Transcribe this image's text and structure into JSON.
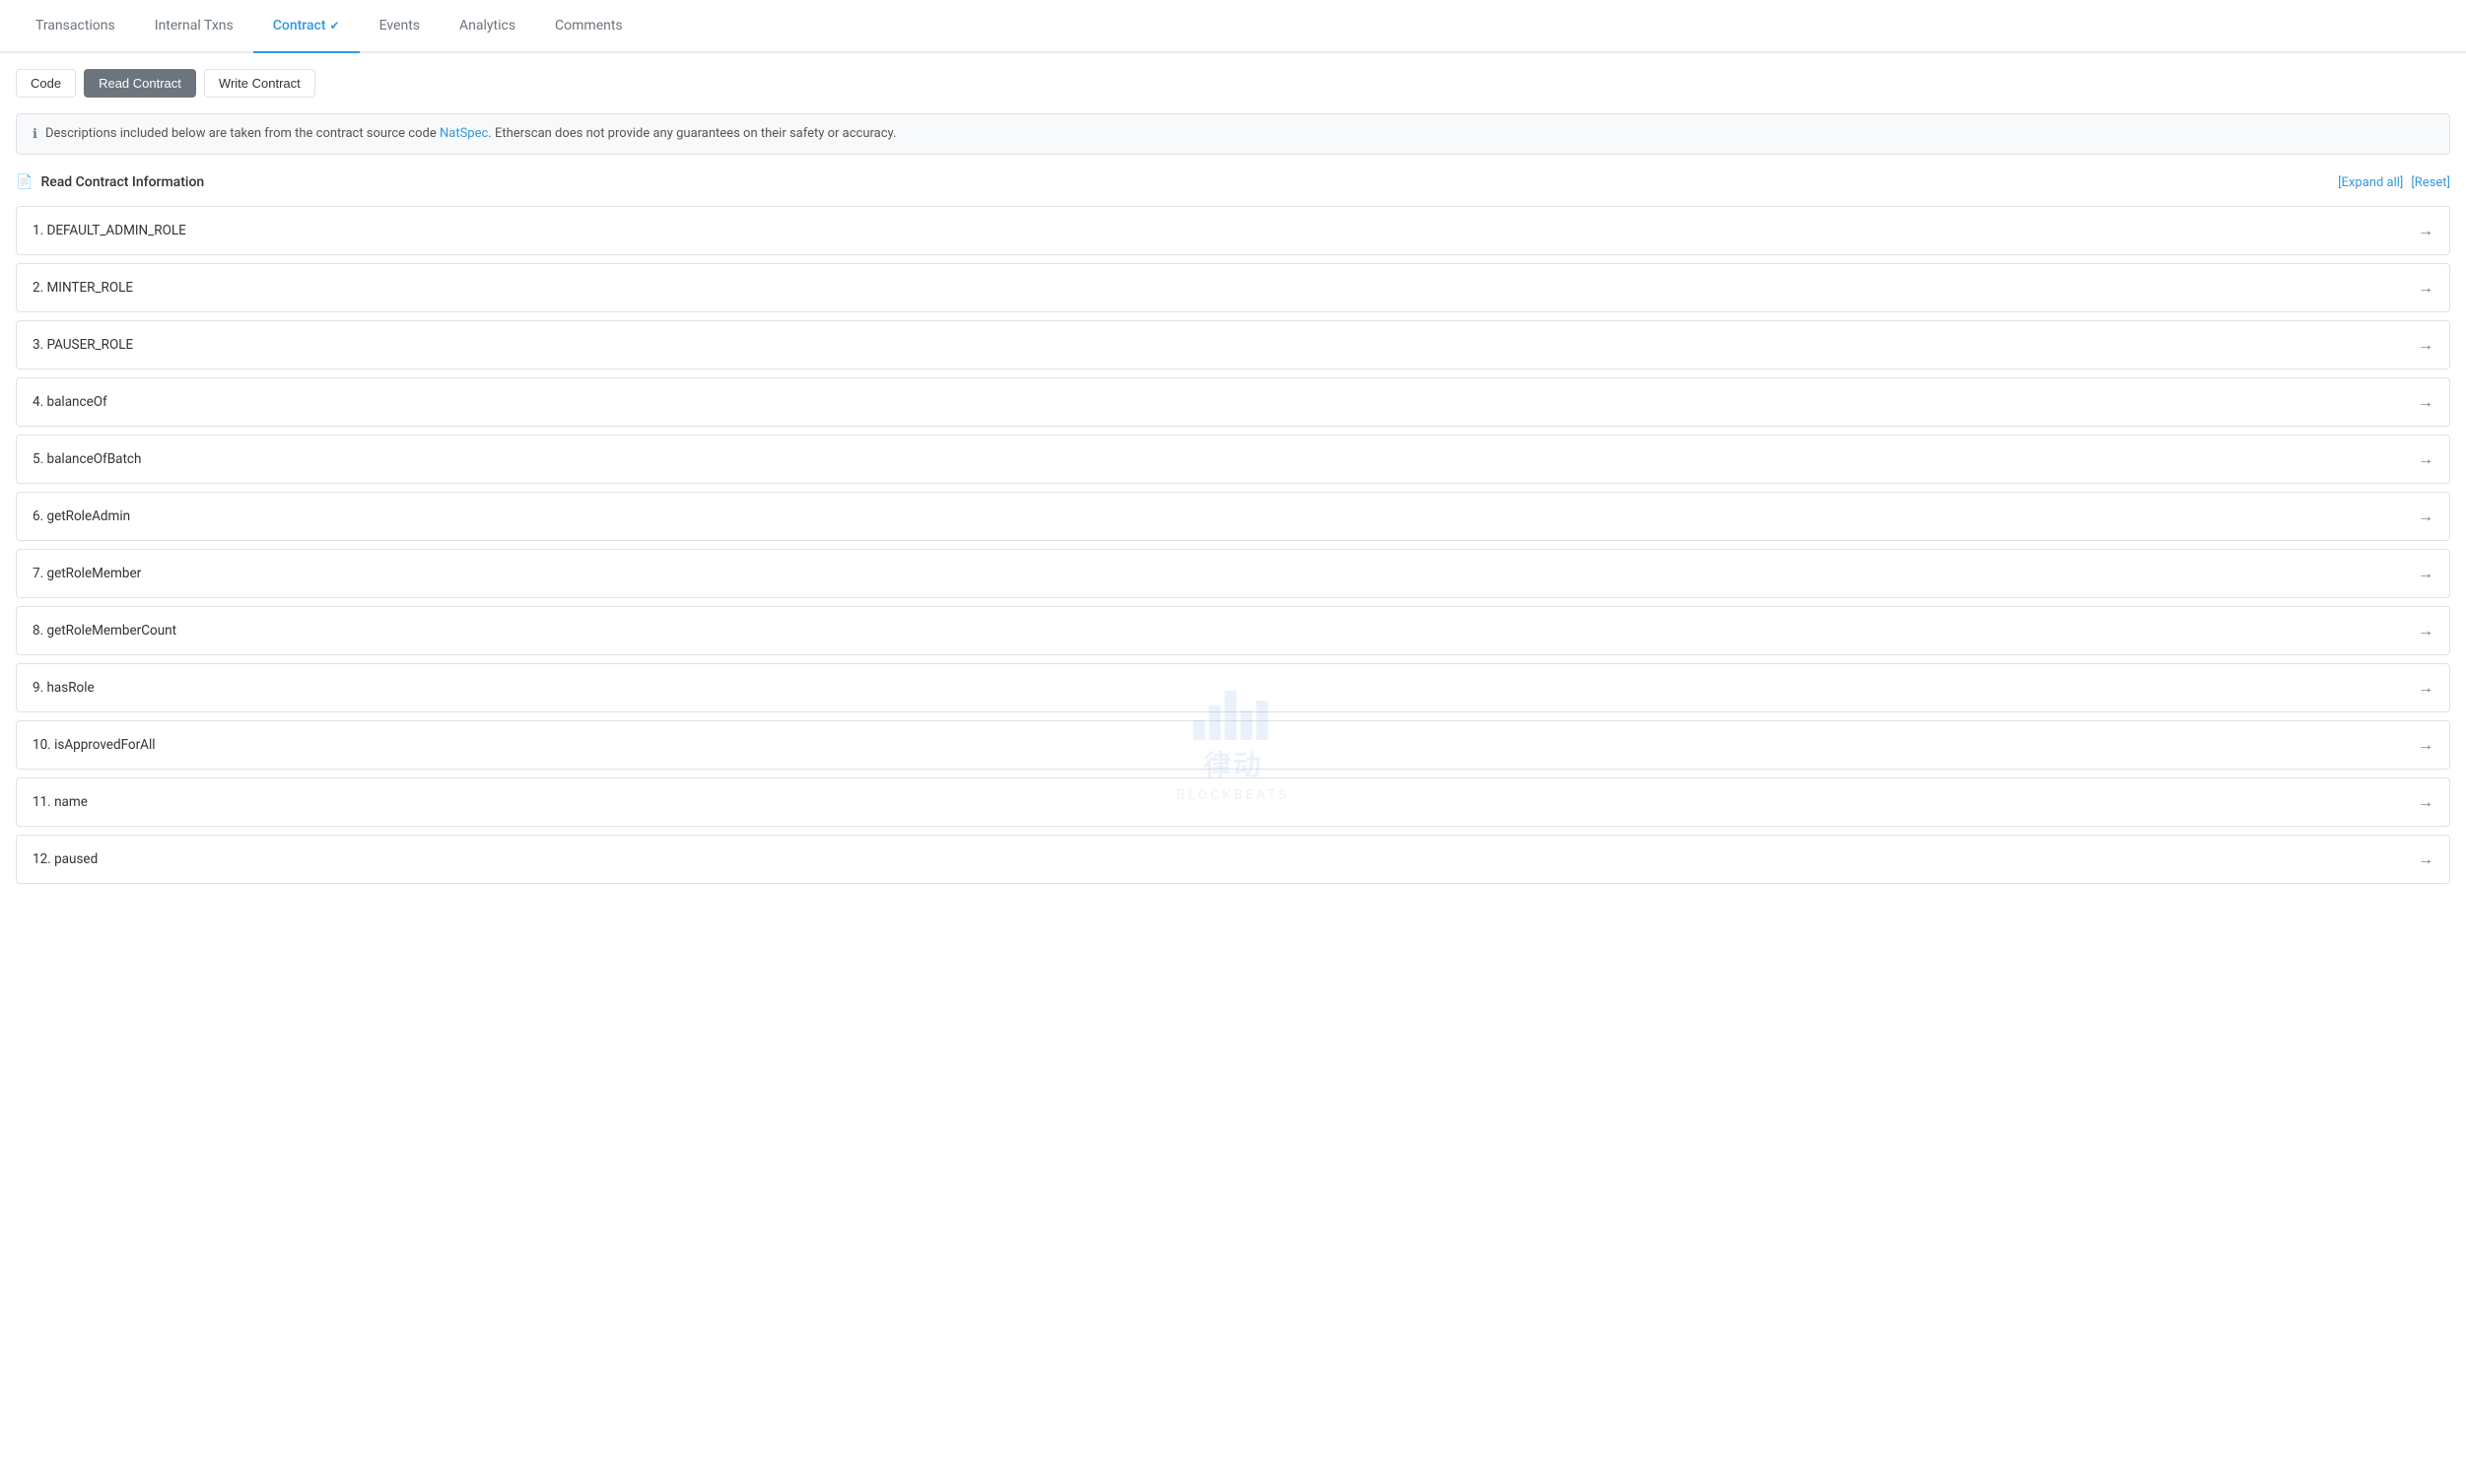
{
  "tabs": [
    {
      "id": "transactions",
      "label": "Transactions",
      "active": false
    },
    {
      "id": "internal-txns",
      "label": "Internal Txns",
      "active": false
    },
    {
      "id": "contract",
      "label": "Contract",
      "active": true,
      "verified": true
    },
    {
      "id": "events",
      "label": "Events",
      "active": false
    },
    {
      "id": "analytics",
      "label": "Analytics",
      "active": false
    },
    {
      "id": "comments",
      "label": "Comments",
      "active": false
    }
  ],
  "buttons": [
    {
      "id": "code",
      "label": "Code",
      "active": false
    },
    {
      "id": "read-contract",
      "label": "Read Contract",
      "active": true
    },
    {
      "id": "write-contract",
      "label": "Write Contract",
      "active": false
    }
  ],
  "info_banner": {
    "text_before": "Descriptions included below are taken from the contract source code ",
    "link_text": "NatSpec",
    "text_after": ". Etherscan does not provide any guarantees on their safety or accuracy."
  },
  "section": {
    "icon": "📄",
    "title": "Read Contract Information",
    "expand_label": "[Expand all]",
    "reset_label": "[Reset]"
  },
  "contract_items": [
    {
      "number": "1",
      "name": "DEFAULT_ADMIN_ROLE"
    },
    {
      "number": "2",
      "name": "MINTER_ROLE"
    },
    {
      "number": "3",
      "name": "PAUSER_ROLE"
    },
    {
      "number": "4",
      "name": "balanceOf"
    },
    {
      "number": "5",
      "name": "balanceOfBatch"
    },
    {
      "number": "6",
      "name": "getRoleAdmin"
    },
    {
      "number": "7",
      "name": "getRoleMember"
    },
    {
      "number": "8",
      "name": "getRoleMemberCount"
    },
    {
      "number": "9",
      "name": "hasRole"
    },
    {
      "number": "10",
      "name": "isApprovedForAll"
    },
    {
      "number": "11",
      "name": "name"
    },
    {
      "number": "12",
      "name": "paused"
    }
  ],
  "watermark": {
    "text": "律动",
    "sub": "BLOCKBEATS"
  }
}
